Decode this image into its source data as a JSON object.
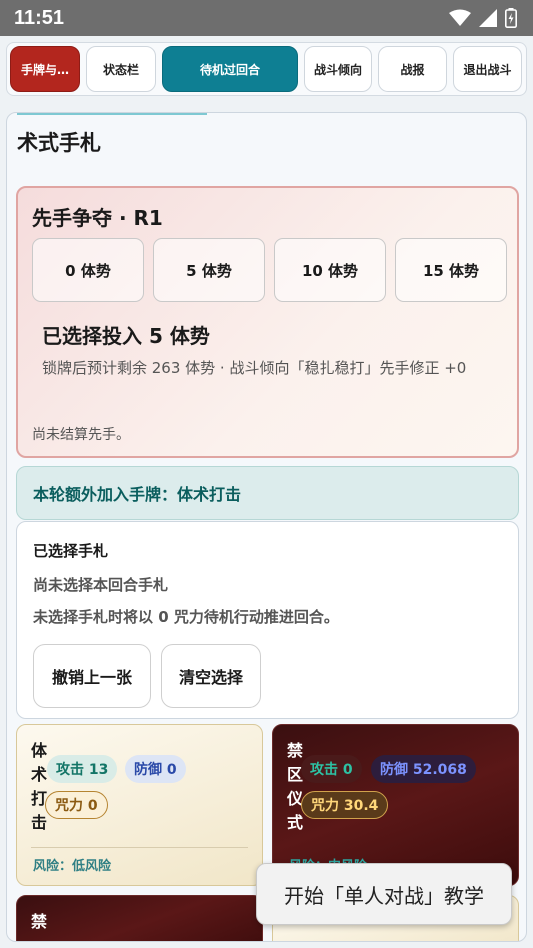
{
  "status_bar": {
    "time": "11:51",
    "icons": [
      "wifi-icon",
      "signal-icon",
      "battery-charging-icon"
    ]
  },
  "tabs": [
    {
      "label": "手牌与…",
      "state": "active-red"
    },
    {
      "label": "状态栏",
      "state": "normal"
    },
    {
      "label": "待机过回合",
      "state": "primary"
    },
    {
      "label": "战斗倾向",
      "state": "normal"
    },
    {
      "label": "战报",
      "state": "normal"
    },
    {
      "label": "退出战斗",
      "state": "normal"
    }
  ],
  "panel": {
    "title": "术式手札"
  },
  "initiative": {
    "title": "先手争夺 · R1",
    "options": [
      "0 体势",
      "5 体势",
      "10 体势",
      "15 体势"
    ],
    "chosen": "已选择投入 5 体势",
    "forecast": "锁牌后预计剩余 263 体势 · 战斗倾向「稳扎稳打」先手修正 +0",
    "unsettled": "尚未结算先手。"
  },
  "extra_card": "本轮额外加入手牌：体术打击",
  "selected": {
    "title": "已选择手札",
    "none": "尚未选择本回合手札",
    "hint": "未选择手札时将以 0 咒力待机行动推进回合。",
    "undo_label": "撤销上一张",
    "clear_label": "清空选择"
  },
  "cards": [
    {
      "name": "体术打击",
      "attack": "攻击 13",
      "defense": "防御 0",
      "mana": "咒力 0",
      "risk": "风险：低风险"
    },
    {
      "name": "禁区仪式",
      "attack": "攻击 0",
      "defense": "防御 52.068",
      "mana": "咒力 30.4",
      "risk": "风险：中风险"
    },
    {
      "name": "禁"
    }
  ],
  "toast": "开始「单人对战」教学",
  "colors": {
    "tab_red": "#b3261e",
    "tab_teal": "#0e7f93",
    "initiative_border": "#e0a5a2",
    "extra_text": "#0b5e5e"
  }
}
